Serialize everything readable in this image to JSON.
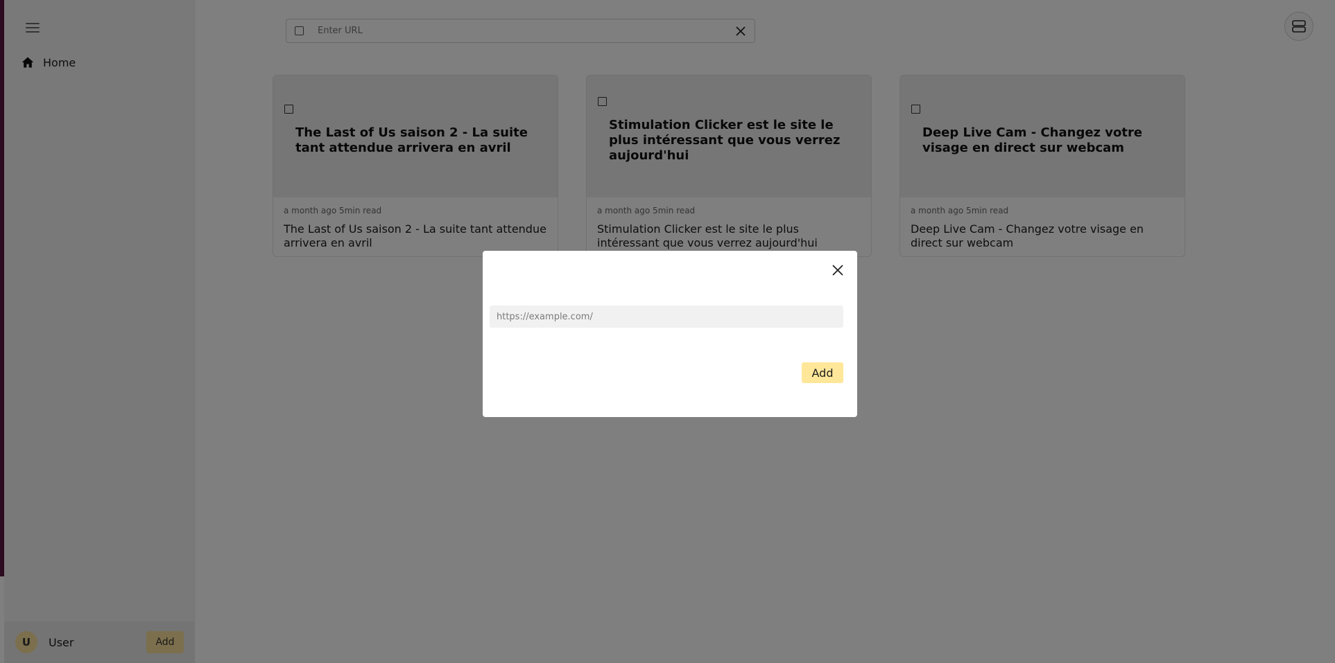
{
  "sidebar": {
    "nav": [
      {
        "label": "Home",
        "icon": "home-icon"
      }
    ],
    "user": {
      "initial": "U",
      "name": "User",
      "add_label": "Add"
    }
  },
  "topbar": {
    "url_placeholder": "Enter URL",
    "layout_icon": "view-rows-icon"
  },
  "cards": [
    {
      "thumb_title": "The Last of Us saison 2 - La suite tant attendue arrivera en avril",
      "meta": "a month ago 5min read",
      "title": "The Last of Us saison 2 - La suite tant attendue arrivera en avril"
    },
    {
      "thumb_title": "Stimulation Clicker est le site le plus intéressant que vous verrez aujourd'hui",
      "meta": "a month ago 5min read",
      "title": "Stimulation Clicker est le site le plus intéressant que vous verrez aujourd'hui"
    },
    {
      "thumb_title": "Deep Live Cam - Changez votre visage en direct sur webcam",
      "meta": "a month ago 5min read",
      "title": "Deep Live Cam - Changez votre visage en direct sur webcam"
    }
  ],
  "modal": {
    "url_placeholder": "https://example.com/",
    "url_value": "",
    "add_label": "Add"
  },
  "colors": {
    "accent": "#ffe79a",
    "edge_strip": "#5a1640",
    "overlay": "rgba(0,0,0,0.5)"
  }
}
